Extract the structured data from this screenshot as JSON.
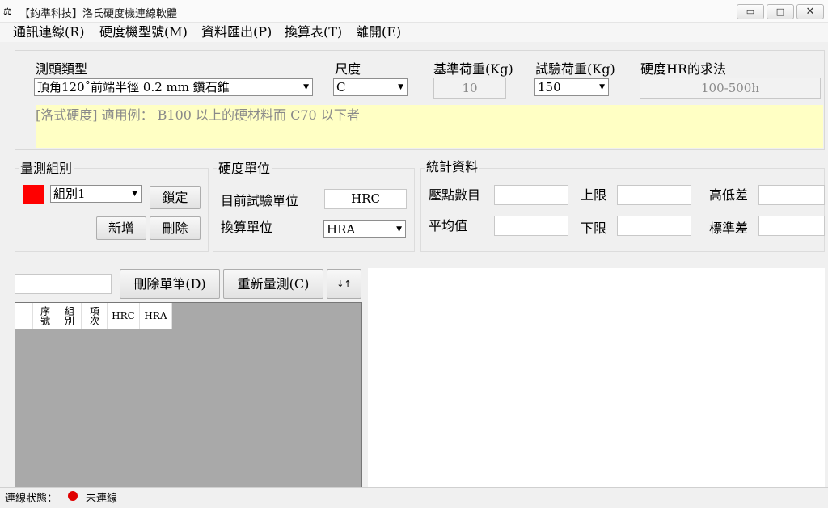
{
  "window": {
    "title": "【鈞準科技】洛氏硬度機連線軟體",
    "icon": "scale-icon",
    "minimize_glyph": "▭",
    "maximize_glyph": "□",
    "close_glyph": "✕"
  },
  "menu": [
    {
      "label": "通訊連線(R)"
    },
    {
      "label": "硬度機型號(M)"
    },
    {
      "label": "資料匯出(P)"
    },
    {
      "label": "換算表(T)"
    },
    {
      "label": "離開(E)"
    }
  ],
  "indenter": {
    "label": "測頭類型",
    "value": "頂角120˚前端半徑 0.2 mm 鑽石錐"
  },
  "scale": {
    "label": "尺度",
    "value": "C"
  },
  "base_load": {
    "label": "基準荷重(Kg)",
    "value": "10"
  },
  "test_load": {
    "label": "試驗荷重(Kg)",
    "value": "150"
  },
  "hr_method": {
    "label": "硬度HR的求法",
    "value": "100-500h"
  },
  "note": "[洛式硬度] 適用例： B100 以上的硬材料而 C70 以下者",
  "group": {
    "title": "量測組別",
    "color": "#ff0000",
    "selected": "組別1",
    "lock_label": "鎖定",
    "add_label": "新增",
    "delete_label": "刪除"
  },
  "units": {
    "title": "硬度單位",
    "current_label": "目前試驗單位",
    "current_value": "HRC",
    "convert_label": "換算單位",
    "convert_value": "HRA"
  },
  "stats": {
    "title": "統計資料",
    "count_label": "壓點數目",
    "max_label": "上限",
    "range_label": "高低差",
    "avg_label": "平均值",
    "min_label": "下限",
    "std_label": "標準差"
  },
  "toolbar": {
    "delete_one_label": "刪除單筆(D)",
    "remeasure_label": "重新量測(C)",
    "sort_glyph": "↓↑"
  },
  "table": {
    "columns": [
      "序號",
      "組別",
      "項次",
      "HRC",
      "HRA"
    ]
  },
  "status": {
    "label": "連線狀態：",
    "value": "未連線",
    "dot_color": "#e00000"
  },
  "dropdown_glyph": "▼"
}
